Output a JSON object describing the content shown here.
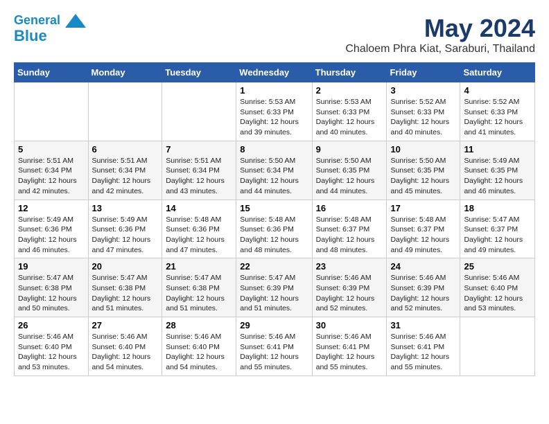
{
  "header": {
    "logo_line1": "General",
    "logo_line2": "Blue",
    "title": "May 2024",
    "subtitle": "Chaloem Phra Kiat, Saraburi, Thailand"
  },
  "days_of_week": [
    "Sunday",
    "Monday",
    "Tuesday",
    "Wednesday",
    "Thursday",
    "Friday",
    "Saturday"
  ],
  "weeks": [
    [
      {
        "day": "",
        "info": ""
      },
      {
        "day": "",
        "info": ""
      },
      {
        "day": "",
        "info": ""
      },
      {
        "day": "1",
        "info": "Sunrise: 5:53 AM\nSunset: 6:33 PM\nDaylight: 12 hours\nand 39 minutes."
      },
      {
        "day": "2",
        "info": "Sunrise: 5:53 AM\nSunset: 6:33 PM\nDaylight: 12 hours\nand 40 minutes."
      },
      {
        "day": "3",
        "info": "Sunrise: 5:52 AM\nSunset: 6:33 PM\nDaylight: 12 hours\nand 40 minutes."
      },
      {
        "day": "4",
        "info": "Sunrise: 5:52 AM\nSunset: 6:33 PM\nDaylight: 12 hours\nand 41 minutes."
      }
    ],
    [
      {
        "day": "5",
        "info": "Sunrise: 5:51 AM\nSunset: 6:34 PM\nDaylight: 12 hours\nand 42 minutes."
      },
      {
        "day": "6",
        "info": "Sunrise: 5:51 AM\nSunset: 6:34 PM\nDaylight: 12 hours\nand 42 minutes."
      },
      {
        "day": "7",
        "info": "Sunrise: 5:51 AM\nSunset: 6:34 PM\nDaylight: 12 hours\nand 43 minutes."
      },
      {
        "day": "8",
        "info": "Sunrise: 5:50 AM\nSunset: 6:34 PM\nDaylight: 12 hours\nand 44 minutes."
      },
      {
        "day": "9",
        "info": "Sunrise: 5:50 AM\nSunset: 6:35 PM\nDaylight: 12 hours\nand 44 minutes."
      },
      {
        "day": "10",
        "info": "Sunrise: 5:50 AM\nSunset: 6:35 PM\nDaylight: 12 hours\nand 45 minutes."
      },
      {
        "day": "11",
        "info": "Sunrise: 5:49 AM\nSunset: 6:35 PM\nDaylight: 12 hours\nand 46 minutes."
      }
    ],
    [
      {
        "day": "12",
        "info": "Sunrise: 5:49 AM\nSunset: 6:36 PM\nDaylight: 12 hours\nand 46 minutes."
      },
      {
        "day": "13",
        "info": "Sunrise: 5:49 AM\nSunset: 6:36 PM\nDaylight: 12 hours\nand 47 minutes."
      },
      {
        "day": "14",
        "info": "Sunrise: 5:48 AM\nSunset: 6:36 PM\nDaylight: 12 hours\nand 47 minutes."
      },
      {
        "day": "15",
        "info": "Sunrise: 5:48 AM\nSunset: 6:36 PM\nDaylight: 12 hours\nand 48 minutes."
      },
      {
        "day": "16",
        "info": "Sunrise: 5:48 AM\nSunset: 6:37 PM\nDaylight: 12 hours\nand 48 minutes."
      },
      {
        "day": "17",
        "info": "Sunrise: 5:48 AM\nSunset: 6:37 PM\nDaylight: 12 hours\nand 49 minutes."
      },
      {
        "day": "18",
        "info": "Sunrise: 5:47 AM\nSunset: 6:37 PM\nDaylight: 12 hours\nand 49 minutes."
      }
    ],
    [
      {
        "day": "19",
        "info": "Sunrise: 5:47 AM\nSunset: 6:38 PM\nDaylight: 12 hours\nand 50 minutes."
      },
      {
        "day": "20",
        "info": "Sunrise: 5:47 AM\nSunset: 6:38 PM\nDaylight: 12 hours\nand 51 minutes."
      },
      {
        "day": "21",
        "info": "Sunrise: 5:47 AM\nSunset: 6:38 PM\nDaylight: 12 hours\nand 51 minutes."
      },
      {
        "day": "22",
        "info": "Sunrise: 5:47 AM\nSunset: 6:39 PM\nDaylight: 12 hours\nand 51 minutes."
      },
      {
        "day": "23",
        "info": "Sunrise: 5:46 AM\nSunset: 6:39 PM\nDaylight: 12 hours\nand 52 minutes."
      },
      {
        "day": "24",
        "info": "Sunrise: 5:46 AM\nSunset: 6:39 PM\nDaylight: 12 hours\nand 52 minutes."
      },
      {
        "day": "25",
        "info": "Sunrise: 5:46 AM\nSunset: 6:40 PM\nDaylight: 12 hours\nand 53 minutes."
      }
    ],
    [
      {
        "day": "26",
        "info": "Sunrise: 5:46 AM\nSunset: 6:40 PM\nDaylight: 12 hours\nand 53 minutes."
      },
      {
        "day": "27",
        "info": "Sunrise: 5:46 AM\nSunset: 6:40 PM\nDaylight: 12 hours\nand 54 minutes."
      },
      {
        "day": "28",
        "info": "Sunrise: 5:46 AM\nSunset: 6:40 PM\nDaylight: 12 hours\nand 54 minutes."
      },
      {
        "day": "29",
        "info": "Sunrise: 5:46 AM\nSunset: 6:41 PM\nDaylight: 12 hours\nand 55 minutes."
      },
      {
        "day": "30",
        "info": "Sunrise: 5:46 AM\nSunset: 6:41 PM\nDaylight: 12 hours\nand 55 minutes."
      },
      {
        "day": "31",
        "info": "Sunrise: 5:46 AM\nSunset: 6:41 PM\nDaylight: 12 hours\nand 55 minutes."
      },
      {
        "day": "",
        "info": ""
      }
    ]
  ]
}
